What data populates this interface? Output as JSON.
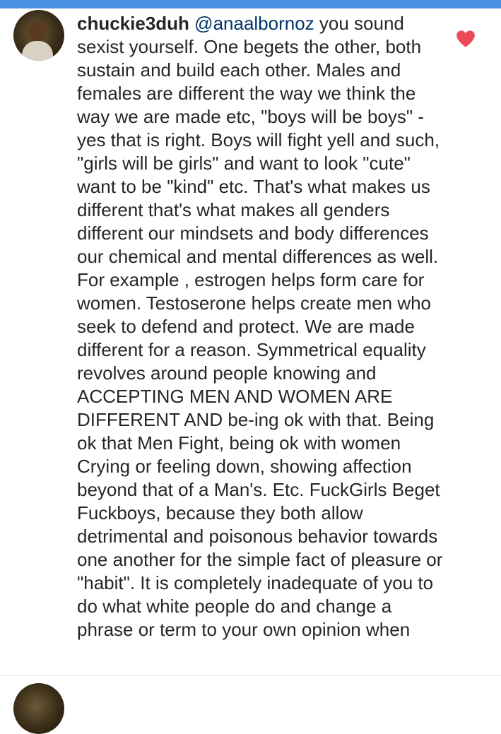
{
  "comment": {
    "username": "chuckie3duh",
    "mention": "@anaalbornoz",
    "body": " you sound sexist yourself. One begets the other, both sustain and build each other. Males and females are different the way we think the way we are made etc, \"boys will be boys\" - yes that is right. Boys will fight yell and such, \"girls will be girls\" and want to look \"cute\" want to be \"kind\" etc. That's what makes us different that's what makes all genders different our mindsets and body differences our chemical and mental differences as well. For example , estrogen helps form care for women. Testoserone helps create men who seek to defend and protect. We are made different for a reason. Symmetrical equality revolves around people knowing and ACCEPTING MEN AND WOMEN ARE DIFFERENT AND be-ing ok with that. Being ok that Men Fight, being ok with women Crying or feeling down, showing affection beyond that of a Man's. Etc. FuckGirls Beget Fuckboys, because they both allow detrimental and poisonous behavior towards one another for the simple fact of pleasure or \"habit\". It is completely inadequate of you to do what white people do and change a phrase or term to your own opinion when",
    "liked": true,
    "heart_color": "#ed4956"
  },
  "icons": {
    "like": "heart-icon"
  },
  "colors": {
    "top_bar": "#4a90e2",
    "mention": "#003569",
    "text": "#262626"
  }
}
